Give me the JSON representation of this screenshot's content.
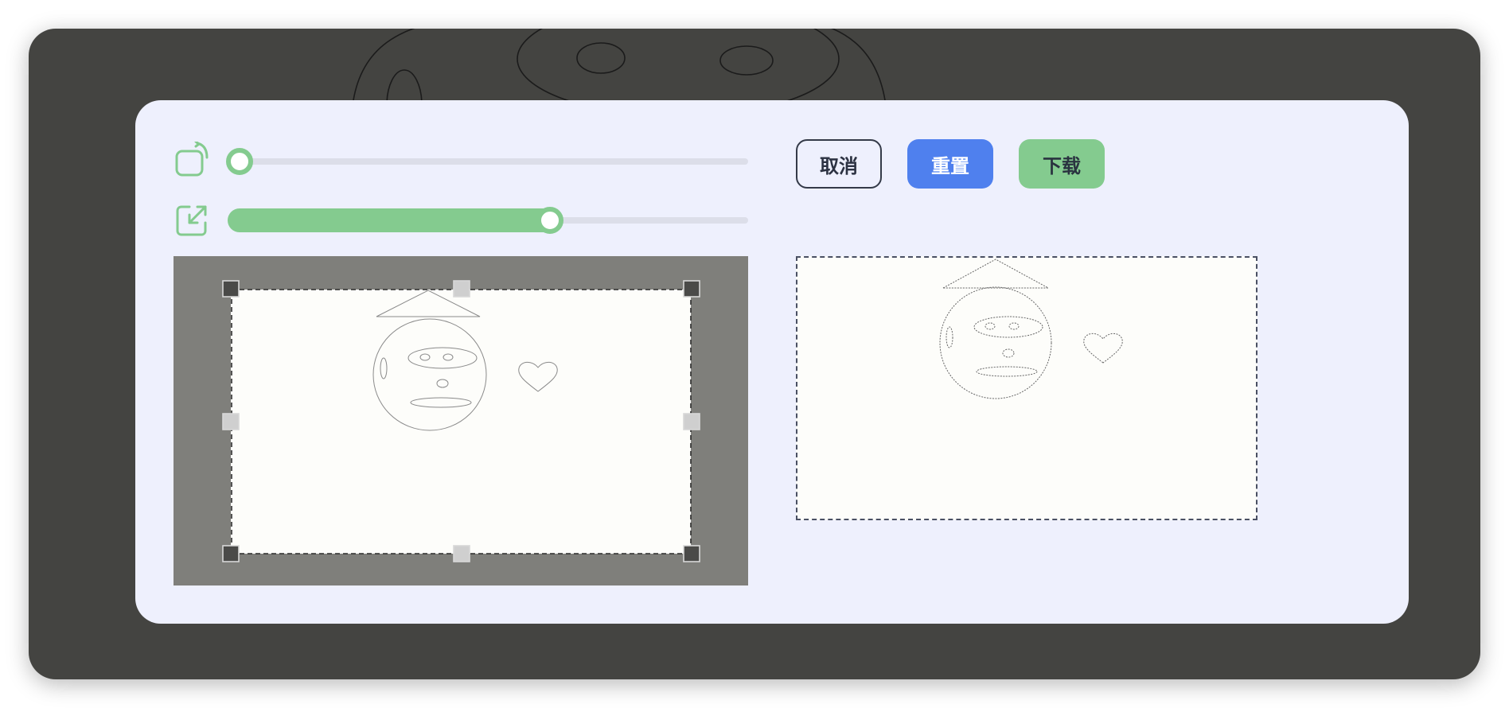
{
  "toolbar": {
    "rotate_icon": "rotate-icon",
    "scale_icon": "resize-icon",
    "rotation": 0,
    "zoom": 0.61
  },
  "buttons": {
    "cancel_label": "取消",
    "reset_label": "重置",
    "download_label": "下载"
  },
  "colors": {
    "accent_green": "#84cb8f",
    "accent_blue": "#4f80ee",
    "modal_bg": "#eef0fd",
    "window_bg": "#444441"
  },
  "crop": {
    "image_content": [
      "face-sketch",
      "heart-sketch"
    ]
  }
}
